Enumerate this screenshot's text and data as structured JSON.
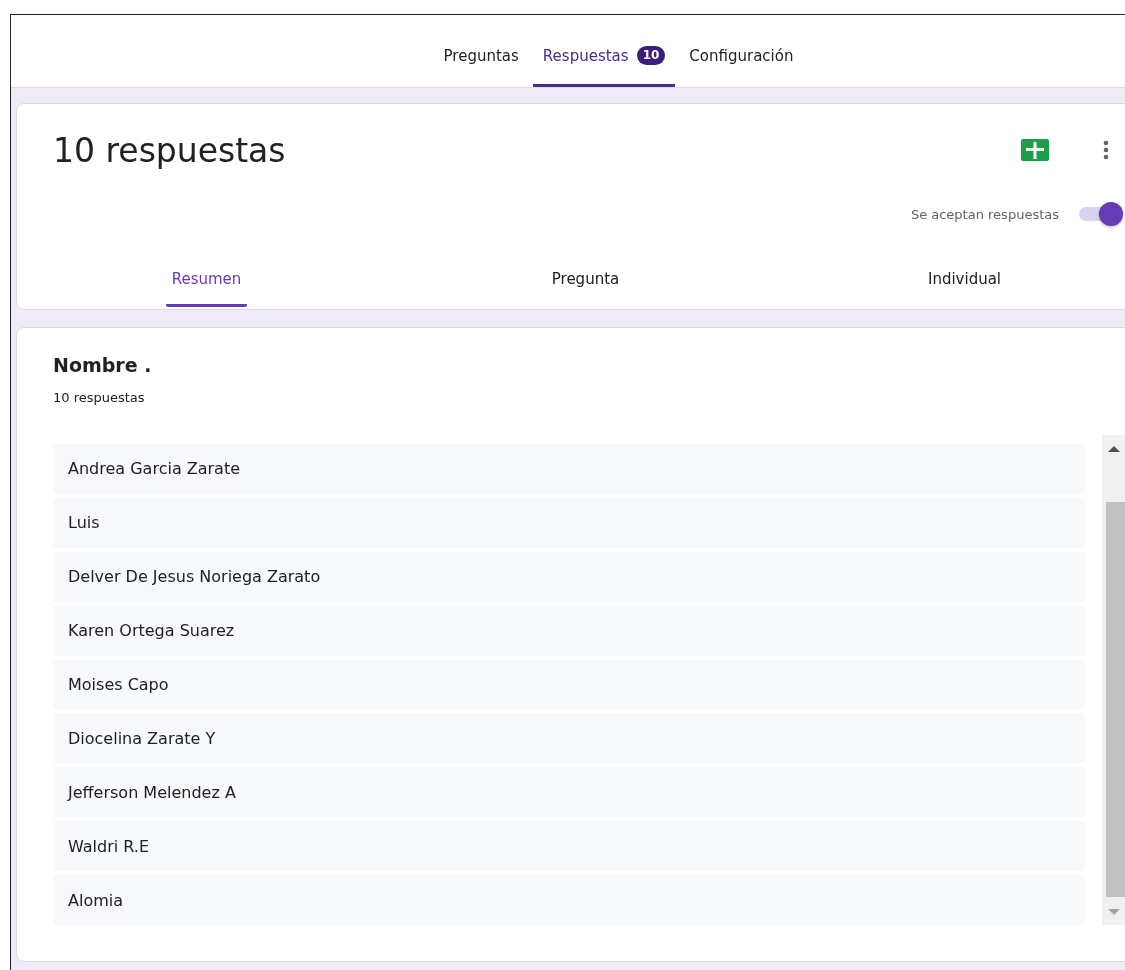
{
  "top_tabs": [
    {
      "label": "Preguntas",
      "selected": false
    },
    {
      "label": "Respuestas",
      "selected": true,
      "badge": "10"
    },
    {
      "label": "Configuración",
      "selected": false
    }
  ],
  "summary": {
    "title": "10 respuestas",
    "accepting_label": "Se aceptan respuestas",
    "accepting": true
  },
  "view_tabs": [
    {
      "label": "Resumen",
      "selected": true
    },
    {
      "label": "Pregunta",
      "selected": false
    },
    {
      "label": "Individual",
      "selected": false
    }
  ],
  "question": {
    "title": "Nombre .",
    "count": "10 respuestas",
    "answers": [
      "Andrea Garcia Zarate",
      "Luis",
      "Delver De Jesus Noriega Zarato",
      "Karen Ortega Suarez",
      "Moises Capo",
      "Diocelina Zarate Y",
      "Jefferson Melendez A",
      "Waldri R.E",
      "Alomia"
    ]
  }
}
